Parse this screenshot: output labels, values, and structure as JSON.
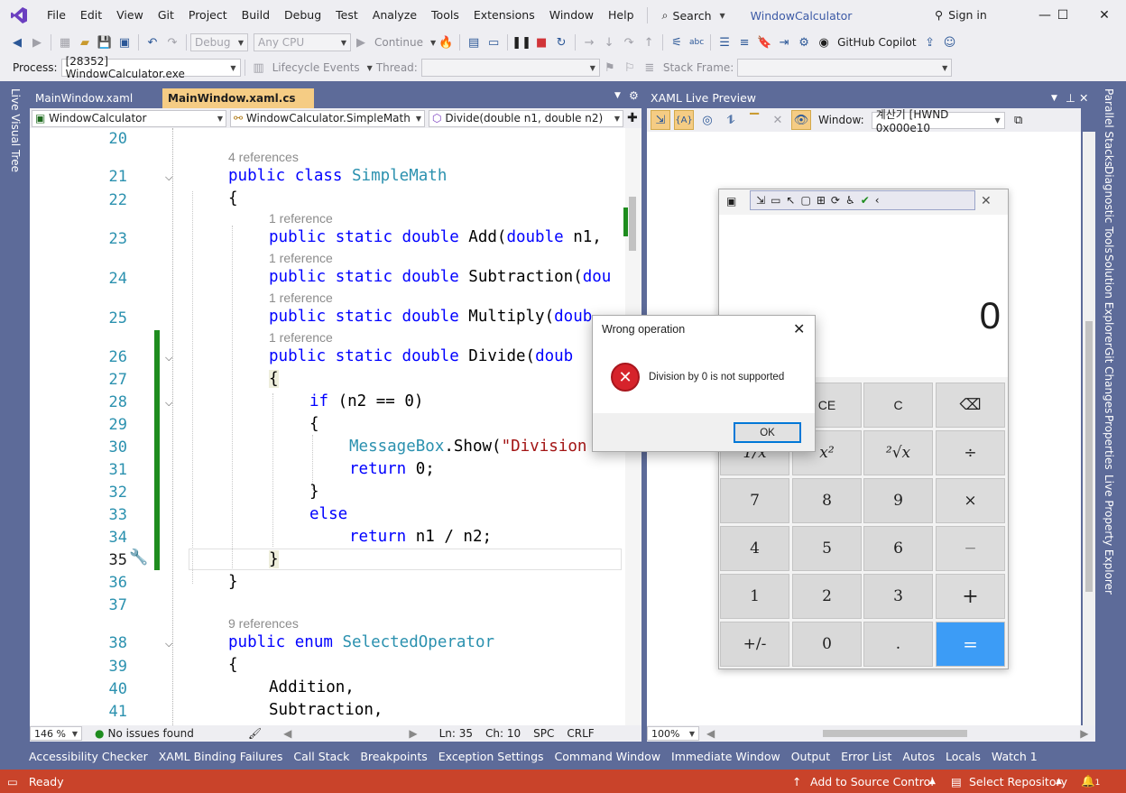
{
  "menu": {
    "items": [
      "File",
      "Edit",
      "View",
      "Git",
      "Project",
      "Build",
      "Debug",
      "Test",
      "Analyze",
      "Tools",
      "Extensions",
      "Window",
      "Help"
    ],
    "search": "Search",
    "app_title": "WindowCalculator",
    "signin": "Sign in"
  },
  "toolbar": {
    "config": "Debug",
    "platform": "Any CPU",
    "continue": "Continue",
    "copilot": "GitHub Copilot"
  },
  "toolbar2": {
    "process_label": "Process:",
    "process_value": "[28352] WindowCalculator.exe",
    "lifecycle": "Lifecycle Events",
    "thread_label": "Thread:",
    "stackframe_label": "Stack Frame:"
  },
  "tabs": {
    "tab1": "MainWindow.xaml",
    "tab2": "MainWindow.xaml.cs",
    "pin": "⊸"
  },
  "nav": {
    "project": "WindowCalculator",
    "class": "WindowCalculator.SimpleMath",
    "member": "Divide(double n1, double n2)"
  },
  "code": {
    "lines": [
      "20",
      "21",
      "22",
      "23",
      "24",
      "25",
      "26",
      "27",
      "28",
      "29",
      "30",
      "31",
      "32",
      "33",
      "34",
      "35",
      "36",
      "37",
      "38",
      "39",
      "40",
      "41"
    ],
    "refs": {
      "r4": "4 references",
      "r1": "1 reference",
      "r9": "9 references"
    },
    "l21": {
      "a": "public",
      "b": "class",
      "c": "SimpleMath"
    },
    "l22": "{",
    "l23": {
      "a": "public",
      "b": "static",
      "c": "double",
      "d": "Add(",
      "e": "double",
      "f": " n1,"
    },
    "l24": {
      "a": "public",
      "b": "static",
      "c": "double",
      "d": "Subtraction(",
      "e": "dou"
    },
    "l25": {
      "a": "public",
      "b": "static",
      "c": "double",
      "d": "Multiply(",
      "e": "doub"
    },
    "l26": {
      "a": "public",
      "b": "static",
      "c": "double",
      "d": "Divide(",
      "e": "doub"
    },
    "l27": "{",
    "l28": {
      "a": "if",
      "b": " (n2 == 0)"
    },
    "l29": "{",
    "l30": {
      "a": "MessageBox",
      "b": ".Show(",
      "c": "\"Division b"
    },
    "l31": {
      "a": "return",
      "b": " 0;"
    },
    "l32": "}",
    "l33": "else",
    "l34": {
      "a": "return",
      "b": " n1 / n2;"
    },
    "l35": "}",
    "l36": "}",
    "l38": {
      "a": "public",
      "b": "enum",
      "c": "SelectedOperator"
    },
    "l39": "{",
    "l40": "Addition,",
    "l41": "Subtraction,"
  },
  "editor_status": {
    "zoom": "146 %",
    "issues": "No issues found",
    "ln": "Ln: 35",
    "ch": "Ch: 10",
    "spc": "SPC",
    "crlf": "CRLF"
  },
  "live_preview": {
    "title": "XAML Live Preview",
    "window_label": "Window:",
    "window_value": "계산기 [HWND 0x000e10",
    "zoom": "100%"
  },
  "calculator": {
    "display": "0",
    "buttons": [
      [
        "1/x",
        "x²",
        "²√x",
        "÷"
      ],
      [
        "7",
        "8",
        "9",
        "×"
      ],
      [
        "4",
        "5",
        "6",
        "−"
      ],
      [
        "1",
        "2",
        "3",
        "+"
      ],
      [
        "+/-",
        "0",
        ".",
        "="
      ]
    ],
    "row0": [
      "CE",
      "C",
      "⌫"
    ]
  },
  "dialog": {
    "title": "Wrong operation",
    "message": "Division by 0 is not supported",
    "ok": "OK"
  },
  "side_tabs": [
    "Parallel Stacks",
    "Diagnostic Tools",
    "Solution Explorer",
    "Git Changes",
    "Properties",
    "Live Property Explorer"
  ],
  "left_tab": "Live Visual Tree",
  "tool_tabs": [
    "Accessibility Checker",
    "XAML Binding Failures",
    "Call Stack",
    "Breakpoints",
    "Exception Settings",
    "Command Window",
    "Immediate Window",
    "Output",
    "Error List",
    "Autos",
    "Locals",
    "Watch 1"
  ],
  "status": {
    "ready": "Ready",
    "source_control": "Add to Source Control",
    "repo": "Select Repository",
    "notif": "1"
  },
  "colors": {
    "accent": "#5d6b99",
    "status": "#c9432a",
    "active_tab": "#f5cc84",
    "keyword": "#0000ff",
    "type": "#2b91af",
    "change_bar": "#1e8c1e",
    "equals": "#3c9cf6"
  }
}
